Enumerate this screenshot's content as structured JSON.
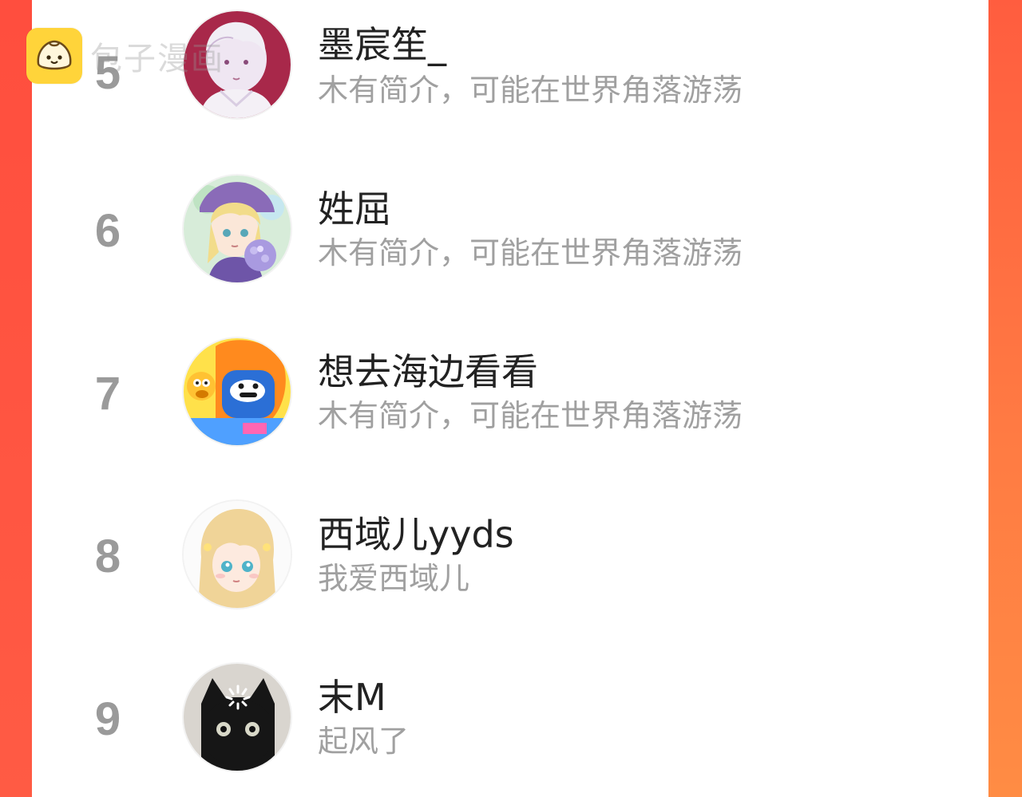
{
  "watermark": {
    "logo_icon": "bun-mascot-icon",
    "text": "包子漫画"
  },
  "colors": {
    "frame_accent": "#ff5a3f",
    "card_background": "#ffffff",
    "rank_color": "#9a9a9a",
    "name_color": "#222222",
    "bio_color": "#a0a0a0",
    "watermark_logo": "#ffd43a"
  },
  "ranking": {
    "items": [
      {
        "rank": "5",
        "name": "墨宸笙_",
        "bio": "木有简介，可能在世界角落游荡",
        "avatar_icon": "avatar-anime-boy-icon"
      },
      {
        "rank": "6",
        "name": "姓屈",
        "bio": "木有简介，可能在世界角落游荡",
        "avatar_icon": "avatar-anime-girl-flowers-icon"
      },
      {
        "rank": "7",
        "name": "想去海边看看",
        "bio": "木有简介，可能在世界角落游荡",
        "avatar_icon": "avatar-cartoon-characters-icon"
      },
      {
        "rank": "8",
        "name": "西域儿yyds",
        "bio": "我爱西域儿",
        "avatar_icon": "avatar-anime-blonde-girl-icon"
      },
      {
        "rank": "9",
        "name": "末M",
        "bio": "起风了",
        "avatar_icon": "avatar-black-cat-icon"
      }
    ]
  }
}
